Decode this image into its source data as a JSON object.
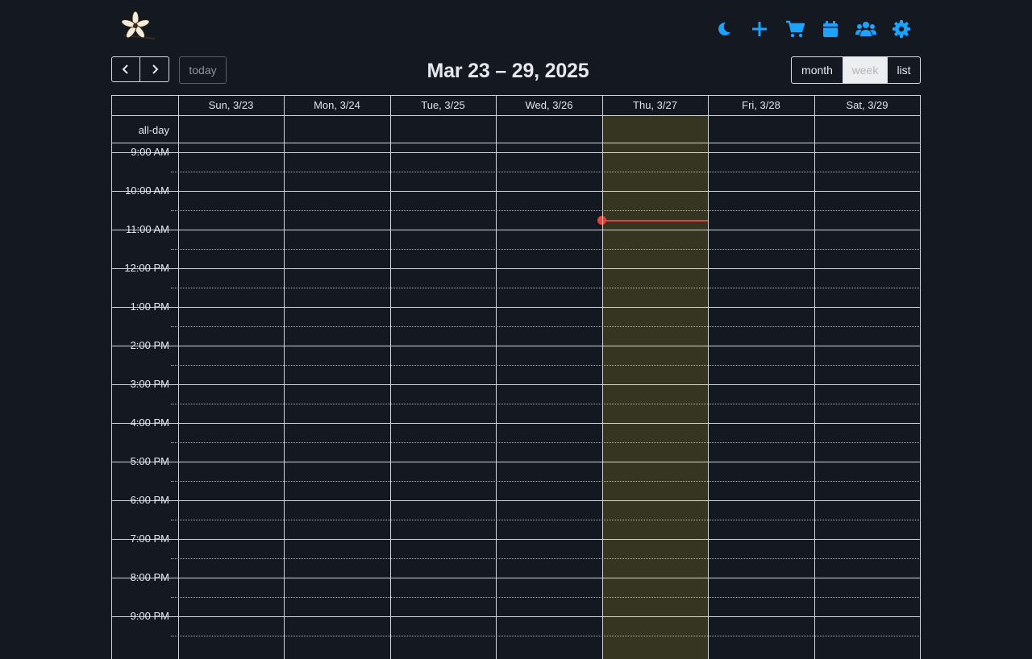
{
  "header": {
    "icons": [
      "moon-icon",
      "plus-icon",
      "cart-icon",
      "calendar-icon",
      "users-icon",
      "gear-icon"
    ]
  },
  "toolbar": {
    "prev_label": "‹",
    "next_label": "›",
    "today_label": "today",
    "title": "Mar 23 – 29, 2025",
    "views": {
      "month": "month",
      "week": "week",
      "list": "list"
    }
  },
  "calendar": {
    "days": [
      "Sun, 3/23",
      "Mon, 3/24",
      "Tue, 3/25",
      "Wed, 3/26",
      "Thu, 3/27",
      "Fri, 3/28",
      "Sat, 3/29"
    ],
    "all_day_label": "all-day",
    "times": [
      "9:00 AM",
      "10:00 AM",
      "11:00 AM",
      "12:00 PM",
      "1:00 PM",
      "2:00 PM",
      "3:00 PM",
      "4:00 PM",
      "5:00 PM",
      "6:00 PM",
      "7:00 PM",
      "8:00 PM",
      "9:00 PM"
    ]
  },
  "colors": {
    "accent": "#1aa3ff",
    "today_bg": "#353522",
    "now_indicator": "#e5423a",
    "background": "#141821"
  }
}
